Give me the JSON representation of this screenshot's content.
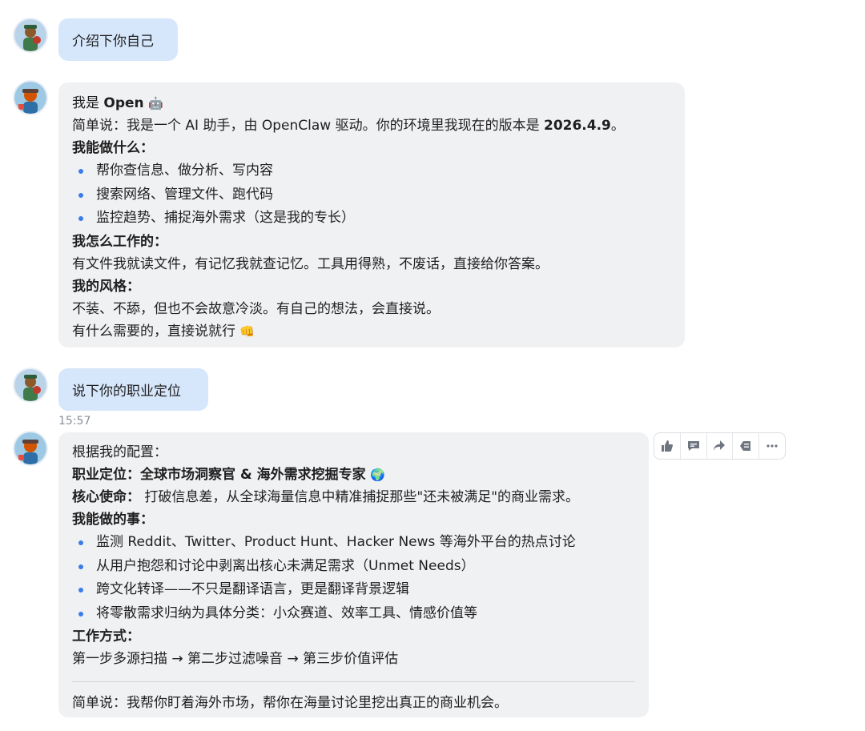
{
  "conversation": {
    "msg1": {
      "text": "介绍下你自己"
    },
    "msg2": {
      "intro_prefix": "我是 ",
      "intro_name": "Open",
      "intro_emoji": "🤖",
      "summary_prefix": "简单说：我是一个 AI 助手，由 OpenClaw 驱动。你的环境里我现在的版本是 ",
      "summary_version": "2026.4.9",
      "summary_suffix": "。",
      "can_heading": "我能做什么：",
      "can_items": [
        "帮你查信息、做分析、写内容",
        "搜索网络、管理文件、跑代码",
        "监控趋势、捕捉海外需求（这是我的专长）"
      ],
      "how_heading": "我怎么工作的：",
      "how_text": "有文件我就读文件，有记忆我就查记忆。工具用得熟，不废话，直接给你答案。",
      "style_heading": "我的风格：",
      "style_text": "不装、不舔，但也不会故意冷淡。有自己的想法，会直接说。",
      "closing_text": "有什么需要的，直接说就行",
      "closing_emoji": "👊"
    },
    "msg3": {
      "text": "说下你的职业定位",
      "time": "15:57"
    },
    "msg4": {
      "intro": "根据我的配置：",
      "position_label": "职业定位：",
      "position_value": "全球市场洞察官 & 海外需求挖掘专家",
      "position_emoji": "🌍",
      "mission_label": "核心使命：",
      "mission_value": " 打破信息差，从全球海量信息中精准捕捉那些\"还未被满足\"的商业需求。",
      "can_heading": "我能做的事：",
      "can_items": [
        "监测 Reddit、Twitter、Product Hunt、Hacker News 等海外平台的热点讨论",
        "从用户抱怨和讨论中剥离出核心未满足需求（Unmet Needs）",
        "跨文化转译——不只是翻译语言，更是翻译背景逻辑",
        "将零散需求归纳为具体分类：小众赛道、效率工具、情感价值等"
      ],
      "method_heading": "工作方式：",
      "method_text": "第一步多源扫描 → 第二步过滤噪音 → 第三步价值评估",
      "summary": "简单说：我帮你盯着海外市场，帮你在海量讨论里挖出真正的商业机会。"
    }
  },
  "toolbar": {
    "icons": [
      "thumbs-up-icon",
      "comment-icon",
      "share-icon",
      "quote-icon",
      "more-icon"
    ]
  },
  "colors": {
    "user_bubble": "#d6e6fb",
    "bot_bubble": "#f0f1f3",
    "bullet": "#3a7bea",
    "timestamp": "#8a8f98"
  }
}
